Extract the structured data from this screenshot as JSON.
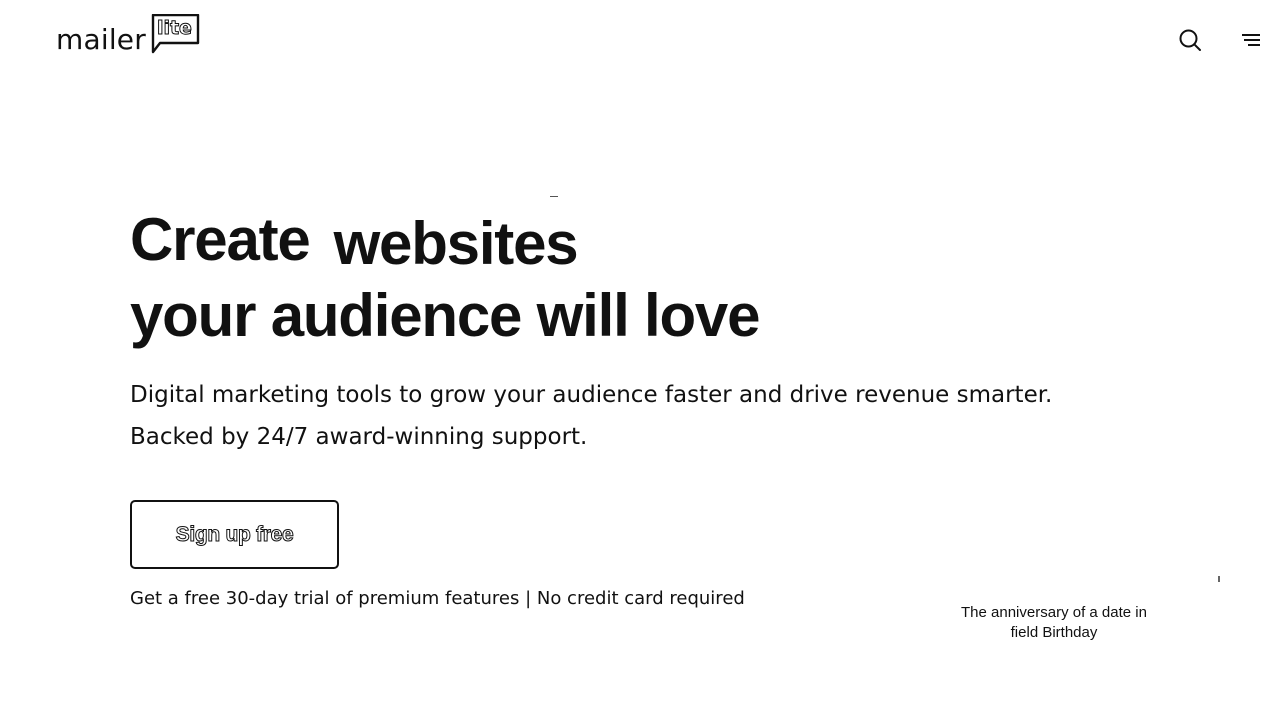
{
  "header": {
    "logo": {
      "word": "mailer",
      "badge": "lite"
    },
    "search_icon": "search-icon",
    "menu_icon": "menu-icon"
  },
  "hero": {
    "headline_prefix": "Create",
    "headline_rotating_word": "websites",
    "headline_line2": "your audience will love",
    "subhead_line1": "Digital marketing tools to grow your audience faster and drive revenue smarter.",
    "subhead_line2": "Backed by 24/7 award-winning support.",
    "cta_label": "Sign up free",
    "trial_note": "Get a free 30-day trial of premium features | No credit card required"
  },
  "tooltip": {
    "line1": "The anniversary of a date in",
    "line2": "field Birthday"
  },
  "colors": {
    "text": "#111111",
    "background": "#ffffff"
  }
}
